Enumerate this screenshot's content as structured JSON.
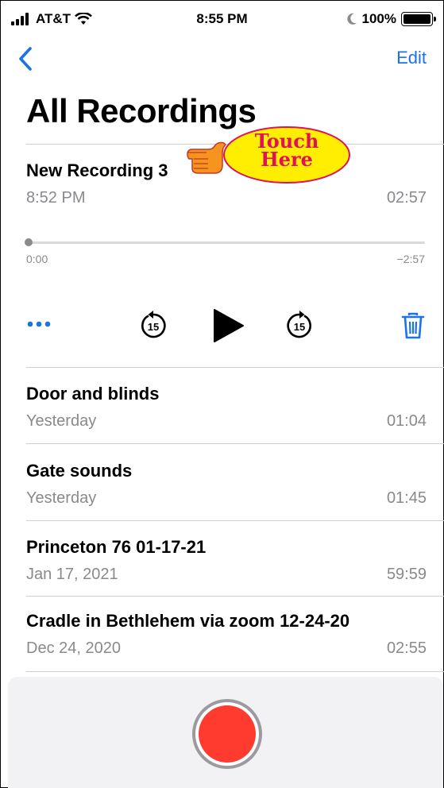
{
  "status_bar": {
    "carrier": "AT&T",
    "time": "8:55 PM",
    "battery": "100%"
  },
  "nav": {
    "edit_label": "Edit"
  },
  "page": {
    "title": "All Recordings"
  },
  "selected_recording": {
    "name": "New Recording 3",
    "date": "8:52 PM",
    "duration": "02:57",
    "elapsed": "0:00",
    "remaining": "−2:57",
    "progress": 0,
    "skip_back_seconds": "15",
    "skip_forward_seconds": "15"
  },
  "recordings": [
    {
      "name": "Door and blinds",
      "date": "Yesterday",
      "duration": "01:04"
    },
    {
      "name": "Gate sounds",
      "date": "Yesterday",
      "duration": "01:45"
    },
    {
      "name": "Princeton 76 01-17-21",
      "date": "Jan 17, 2021",
      "duration": "59:59"
    },
    {
      "name": "Cradle in Bethlehem via zoom 12-24-20",
      "date": "Dec 24, 2020",
      "duration": "02:55"
    }
  ],
  "annotation": {
    "line1": "Touch",
    "line2": "Here"
  },
  "colors": {
    "accent": "#1a73e8",
    "record": "#ff3b30",
    "annotation_text": "#e0105a",
    "callout_fill": "#ffee00",
    "hand": "#f7941d"
  },
  "icons": [
    "signal-icon",
    "wifi-icon",
    "moon-icon",
    "battery-icon",
    "back-chevron-icon",
    "more-icon",
    "skip-back-15-icon",
    "play-icon",
    "skip-forward-15-icon",
    "trash-icon",
    "record-icon",
    "pointing-hand-icon"
  ]
}
